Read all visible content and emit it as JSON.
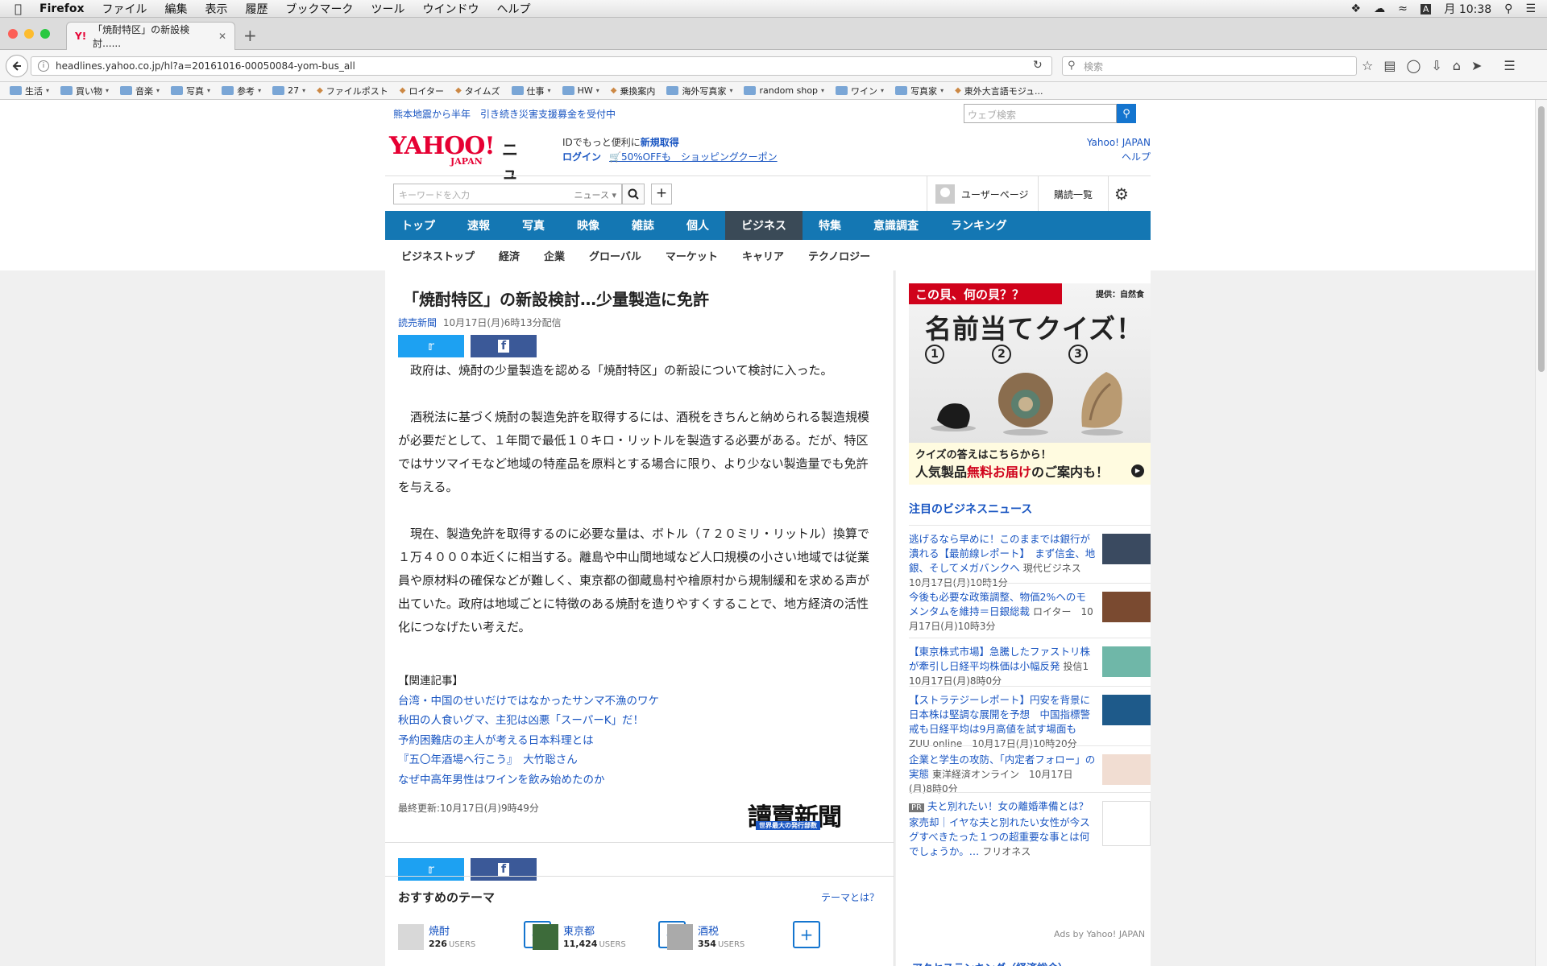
{
  "menubar": {
    "app": "Firefox",
    "items": [
      "ファイル",
      "編集",
      "表示",
      "履歴",
      "ブックマーク",
      "ツール",
      "ウインドウ",
      "ヘルプ"
    ],
    "clock": "月 10:38"
  },
  "tab": {
    "title": "「焼酎特区」の新設検討......",
    "favicon": "Y!"
  },
  "nav": {
    "url": "headlines.yahoo.co.jp/hl?a=20161016-00050084-yom-bus_all",
    "search_placeholder": "検索"
  },
  "bookmarks": [
    {
      "label": "生活",
      "folder": true
    },
    {
      "label": "買い物",
      "folder": true
    },
    {
      "label": "音楽",
      "folder": true
    },
    {
      "label": "写真",
      "folder": true
    },
    {
      "label": "参考",
      "folder": true
    },
    {
      "label": "27",
      "folder": true
    },
    {
      "label": "ファイルポスト",
      "folder": false
    },
    {
      "label": "ロイター",
      "folder": false
    },
    {
      "label": "タイムズ",
      "folder": false
    },
    {
      "label": "仕事",
      "folder": true
    },
    {
      "label": "HW",
      "folder": true
    },
    {
      "label": "乗換案内",
      "folder": false
    },
    {
      "label": "海外写真家",
      "folder": true
    },
    {
      "label": "random shop",
      "folder": true
    },
    {
      "label": "ワイン",
      "folder": true
    },
    {
      "label": "写真家",
      "folder": true
    },
    {
      "label": "東外大言語モジュ...",
      "folder": false
    }
  ],
  "header": {
    "alert": "熊本地震から半年　引き続き災害支援募金を受付中",
    "web_search_placeholder": "ウェブ検索",
    "logo": "YAHOO!",
    "logo_sub": "JAPAN",
    "section": "ニュース",
    "id_text": "IDでもっと便利に",
    "id_link": "新規取得",
    "login": "ログイン",
    "coupon": "50%OFFも　ショッピングクーポン",
    "yj_link": "Yahoo! JAPAN",
    "help": "ヘルプ",
    "keyword_placeholder": "キーワードを入力",
    "keyword_scope": "ニュース",
    "user_page": "ユーザーページ",
    "subscriptions": "購読一覧"
  },
  "main_nav": [
    {
      "label": "トップ",
      "active": false
    },
    {
      "label": "速報",
      "active": false
    },
    {
      "label": "写真",
      "active": false
    },
    {
      "label": "映像",
      "active": false
    },
    {
      "label": "雑誌",
      "active": false
    },
    {
      "label": "個人",
      "active": false
    },
    {
      "label": "ビジネス",
      "active": true
    },
    {
      "label": "特集",
      "active": false
    },
    {
      "label": "意識調査",
      "active": false
    },
    {
      "label": "ランキング",
      "active": false
    }
  ],
  "sub_nav": [
    "ビジネストップ",
    "経済",
    "企業",
    "グローバル",
    "マーケット",
    "キャリア",
    "テクノロジー"
  ],
  "article": {
    "title": "「焼酎特区」の新設検討…少量製造に免許",
    "source": "読売新聞",
    "date": "10月17日(月)6時13分配信",
    "paragraphs": [
      "政府は、焼酎の少量製造を認める「焼酎特区」の新設について検討に入った。",
      "酒税法に基づく焼酎の製造免許を取得するには、酒税をきちんと納められる製造規模が必要だとして、１年間で最低１０キロ・リットルを製造する必要がある。だが、特区ではサツマイモなど地域の特産品を原料とする場合に限り、より少ない製造量でも免許を与える。",
      "現在、製造免許を取得するのに必要な量は、ボトル（７２０ミリ・リットル）換算で１万４０００本近くに相当する。離島や中山間地域など人口規模の小さい地域では従業員や原材料の確保などが難しく、東京都の御蔵島村や檜原村から規制緩和を求める声が出ていた。政府は地域ごとに特徴のある焼酎を造りやすくすることで、地方経済の活性化につなげたい考えだ。"
    ],
    "related_heading": "【関連記事】",
    "related": [
      "台湾・中国のせいだけではなかったサンマ不漁のワケ",
      "秋田の人食いグマ、主犯は凶悪「スーパーK」だ！",
      "予約困難店の主人が考える日本料理とは",
      "『五〇年酒場へ行こう』　大竹聡さん",
      "なぜ中高年男性はワインを飲み始めたのか"
    ],
    "updated": "最終更新:10月17日(月)9時49分",
    "publisher_logo": "讀賣新聞",
    "publisher_sub": "世界最大の発行部数"
  },
  "themes": {
    "heading": "おすすめのテーマ",
    "what": "テーマとは？",
    "items": [
      {
        "name": "焼酎",
        "count": "226",
        "unit": "USERS"
      },
      {
        "name": "東京都",
        "count": "11,424",
        "unit": "USERS"
      },
      {
        "name": "酒税",
        "count": "354",
        "unit": "USERS"
      }
    ]
  },
  "ad": {
    "top": "この貝、何の貝？？",
    "provider": "提供：自然食",
    "title": "名前当てクイズ！",
    "numbers": [
      "1",
      "2",
      "3"
    ],
    "bottom1": "クイズの答えはこちらから！",
    "bottom2a": "人気製品",
    "bottom2b": "無料お届け",
    "bottom2c": "のご案内も！"
  },
  "sidebar": {
    "heading": "注目のビジネスニュース",
    "items": [
      {
        "title": "逃げるなら早めに！このままでは銀行が潰れる【最前線レポート】　まず信金、地銀、そしてメガバンクへ",
        "source": "現代ビジネス　10月17日(月)10時1分",
        "pr": false
      },
      {
        "title": "今後も必要な政策調整、物価2%へのモメンタムを維持＝日銀総裁",
        "source": "ロイター　10月17日(月)10時3分",
        "pr": false
      },
      {
        "title": "【東京株式市場】急騰したファストリ株が牽引し日経平均株価は小幅反発",
        "source": "投信1　10月17日(月)8時0分",
        "pr": false
      },
      {
        "title": "【ストラテジーレポート】円安を背景に日本株は堅調な展開を予想　中国指標警戒も日経平均は9月高値を試す場面も",
        "source": "ZUU online　10月17日(月)10時20分",
        "pr": false
      },
      {
        "title": "企業と学生の攻防、「内定者フォロー」の実態",
        "source": "東洋経済オンライン　10月17日(月)8時0分",
        "pr": false
      },
      {
        "title": "夫と別れたい！女の離婚準備とは？家売却｜イヤな夫と別れたい女性が今スグすべきたった１つの超重要な事とは何でしょうか。…",
        "source": "フリオネス",
        "pr": true,
        "pr_label": "PR"
      }
    ],
    "ads_by": "Ads by Yahoo! JAPAN",
    "ranking": "アクセスランキング（経済総合）"
  }
}
